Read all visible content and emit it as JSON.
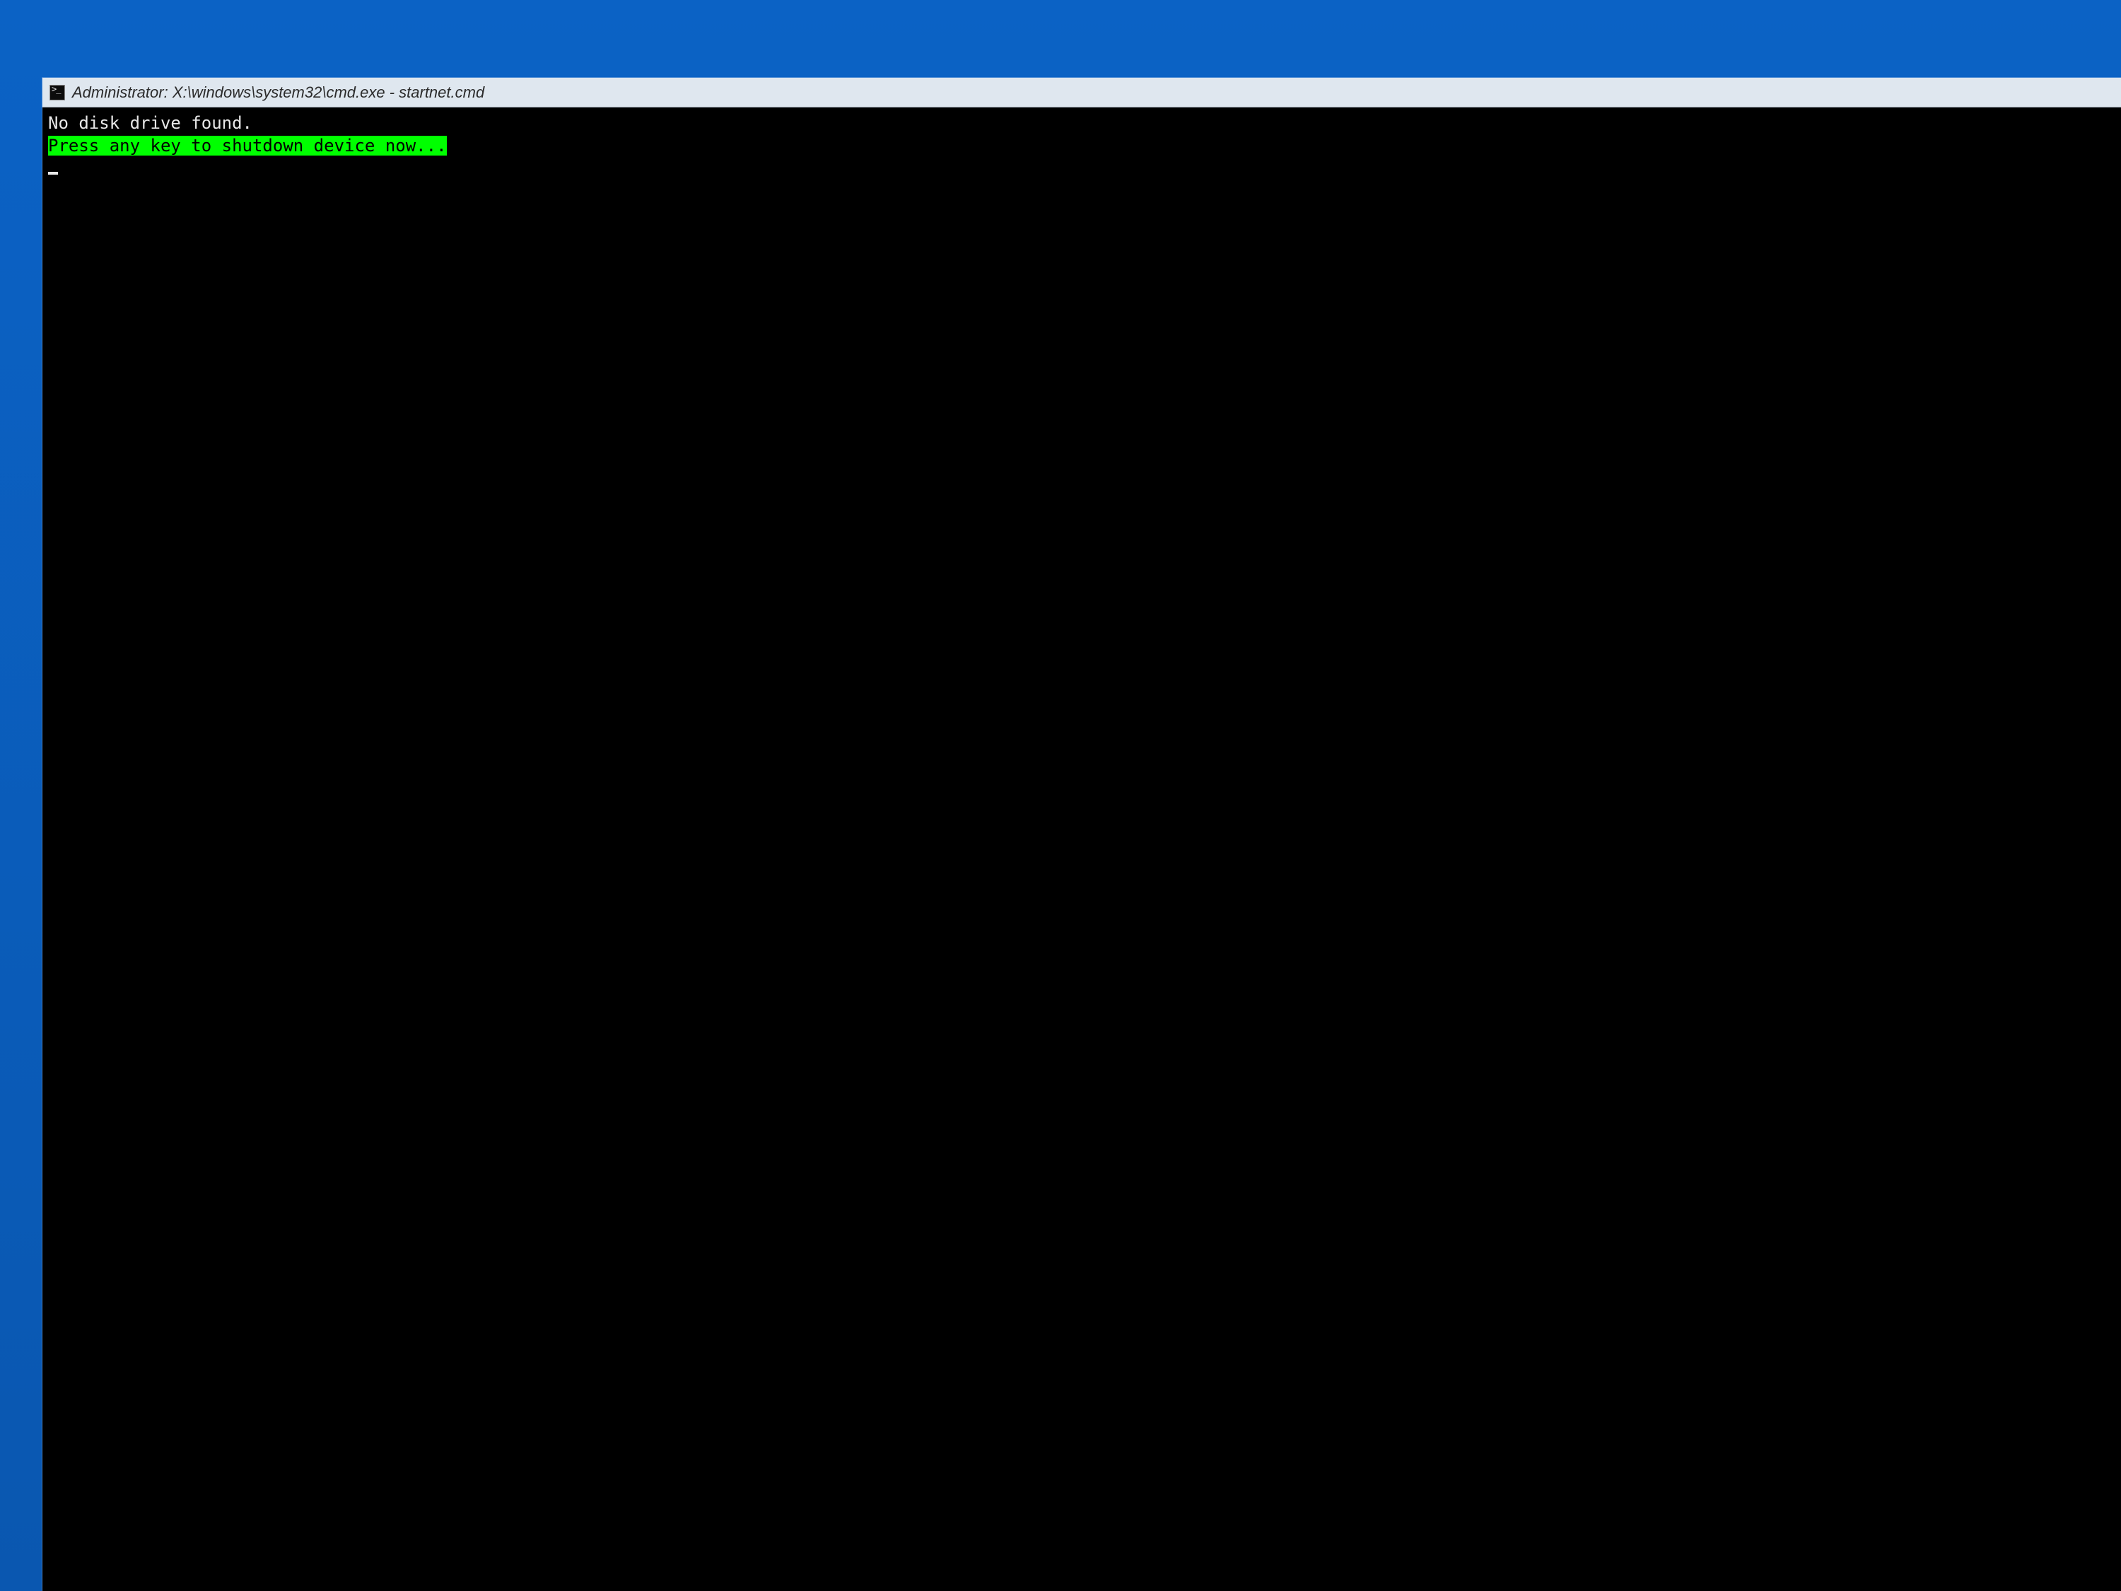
{
  "window": {
    "title": "Administrator: X:\\windows\\system32\\cmd.exe - startnet.cmd"
  },
  "terminal": {
    "line1": "No disk drive found.",
    "line2": "Press any key to shutdown device now..."
  },
  "colors": {
    "desktop_blue": "#0a5dbb",
    "highlight_bg": "#00ff00",
    "highlight_fg": "#000000",
    "term_bg": "#000000",
    "term_fg": "#e8e8e8",
    "titlebar_bg": "#dfe7ef"
  }
}
